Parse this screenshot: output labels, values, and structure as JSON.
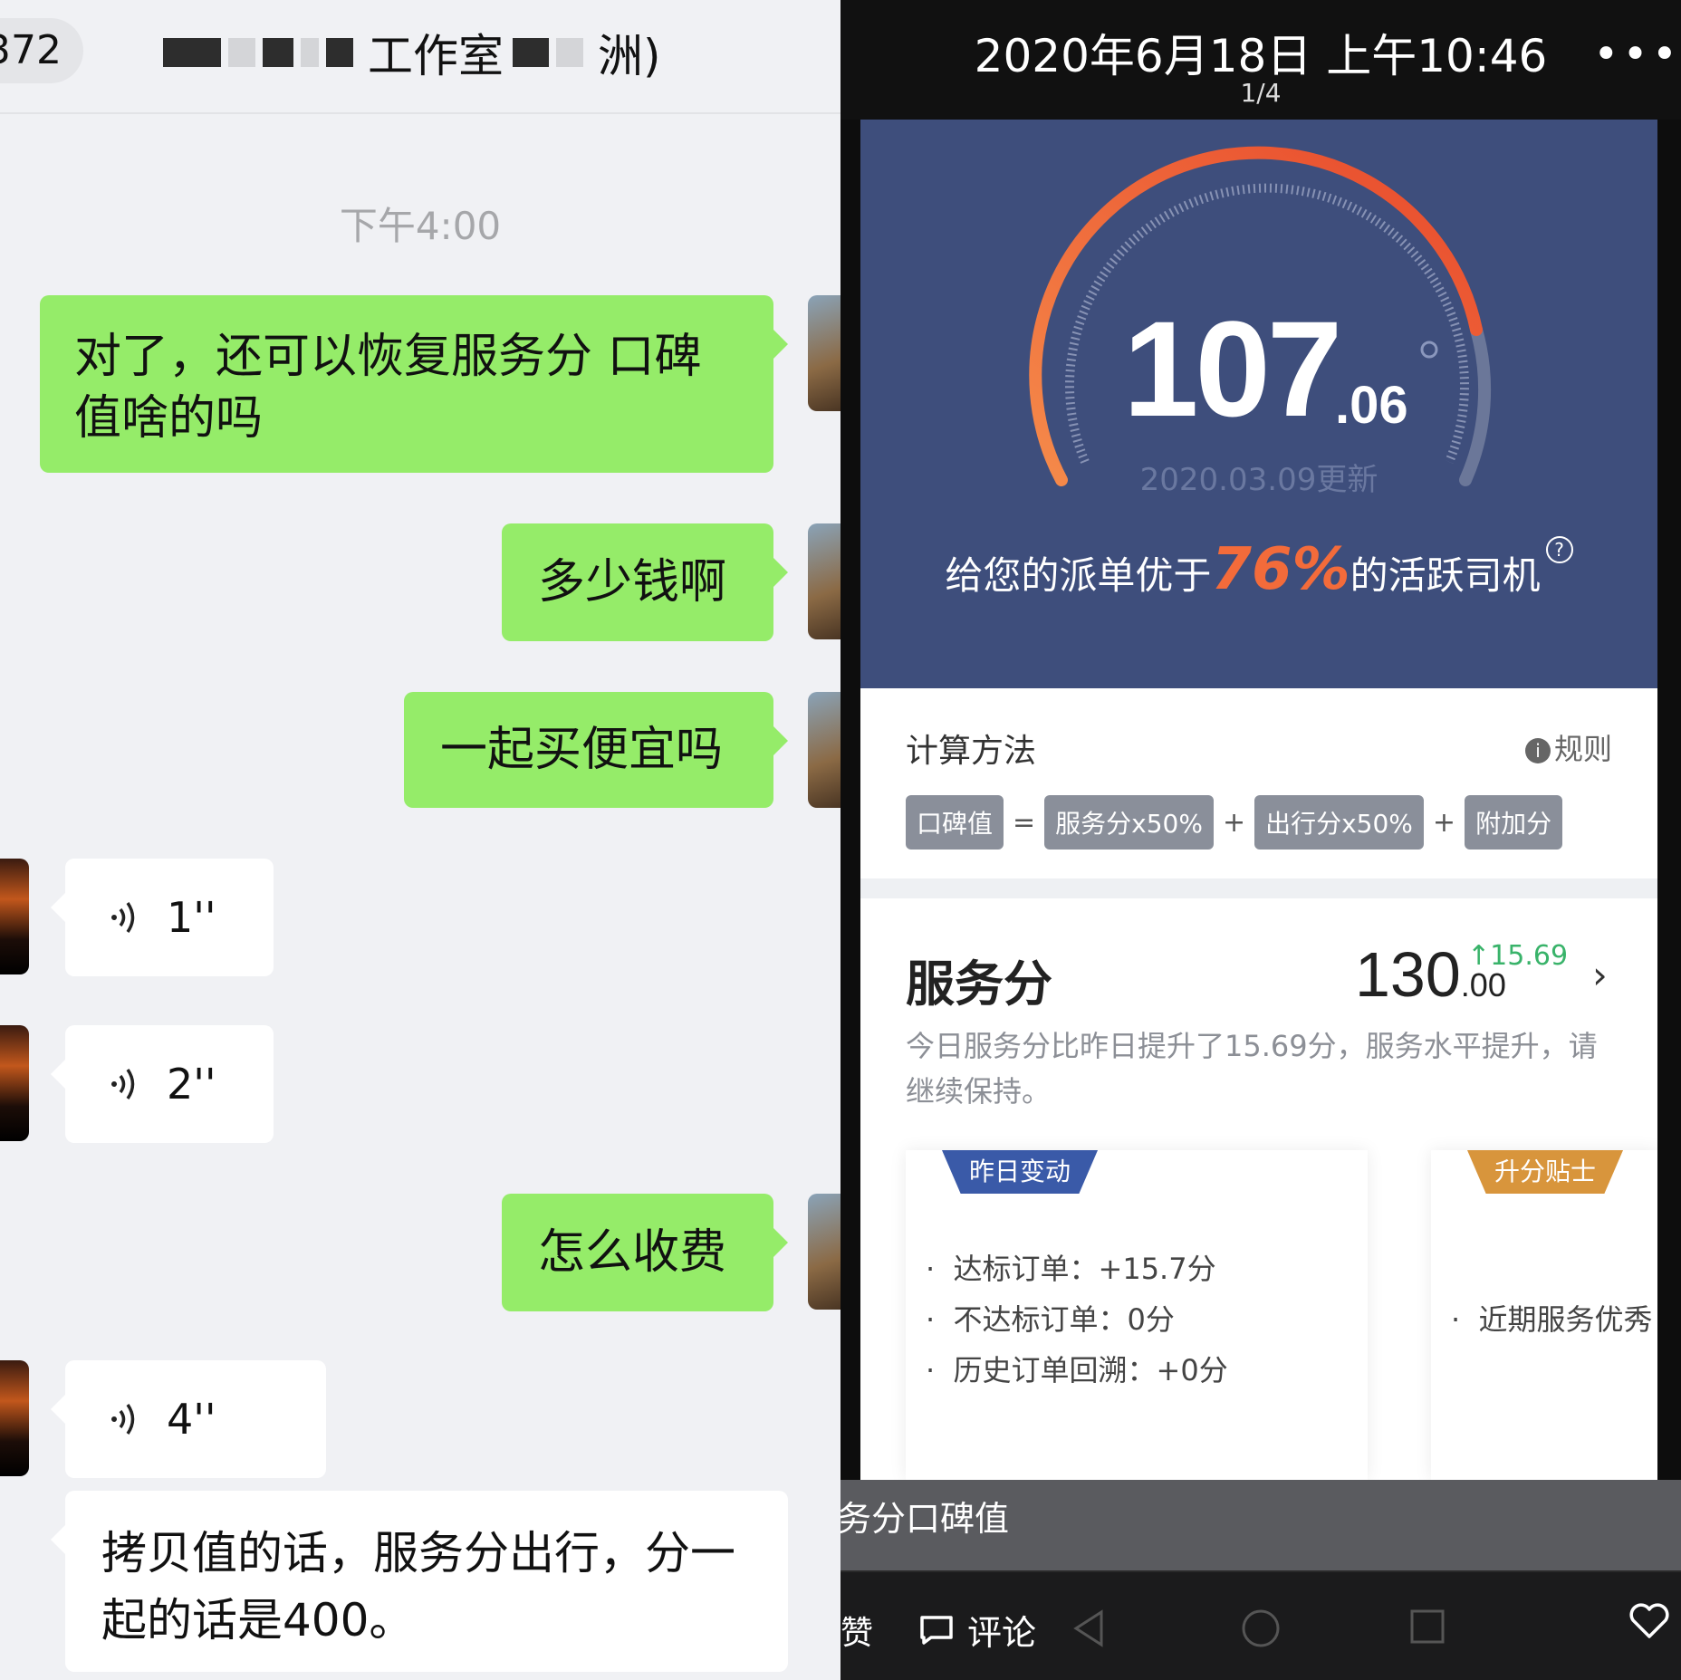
{
  "chat": {
    "back_count": "372",
    "title_visible": "工作室",
    "title_tail": "洲)",
    "time": "下午4:00",
    "messages": [
      {
        "from": "me",
        "text": "对了，还可以恢复服务分 口碑值啥的吗"
      },
      {
        "from": "me",
        "text": "多少钱啊"
      },
      {
        "from": "me",
        "text": "一起买便宜吗"
      },
      {
        "from": "other",
        "type": "voice",
        "duration": "1''"
      },
      {
        "from": "other",
        "type": "voice",
        "duration": "2''"
      },
      {
        "from": "me",
        "text": "怎么收费"
      },
      {
        "from": "other",
        "type": "voice",
        "duration": "4''"
      },
      {
        "from": "other",
        "text": "拷贝值的话，服务分出行，分一起的话是400。"
      }
    ]
  },
  "viewer": {
    "datetime": "2020年6月18日 上午10:46",
    "page": "1/4",
    "more": "•••",
    "gauge": {
      "score_int": "107",
      "score_dec": ".06",
      "updated": "2020.03.09更新",
      "rank_prefix": "给您的派单优于",
      "rank_pct": "76%",
      "rank_suffix": "的活跃司机",
      "help": "?"
    },
    "calc": {
      "title": "计算方法",
      "rule": "规则",
      "chips": [
        "口碑值",
        "服务分x50%",
        "出行分x50%",
        "附加分"
      ],
      "ops": [
        "=",
        "+",
        "+"
      ]
    },
    "service": {
      "title": "服务分",
      "value_int": "130",
      "value_dec": ".00",
      "delta": "15.69",
      "desc": "今日服务分比昨日提升了15.69分，服务水平提升，请继续保持。",
      "card_left": {
        "tag": "昨日变动",
        "items": [
          "达标订单：+15.7分",
          "不达标订单：0分",
          "历史订单回溯：+0分"
        ]
      },
      "card_right": {
        "tag": "升分贴士",
        "items": [
          "近期服务优秀"
        ]
      }
    },
    "caption": "务分口碑值",
    "bottom": {
      "like": "赞",
      "comment": "评论"
    },
    "colors": {
      "accent": "#f36b3a",
      "panel": "#3e4e7c",
      "bubble": "#95ec69",
      "up": "#39b36a"
    }
  }
}
